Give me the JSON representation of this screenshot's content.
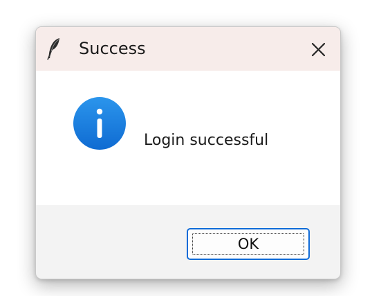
{
  "window": {
    "title": "Success",
    "app_icon": "feather-icon",
    "close_icon": "close-icon"
  },
  "dialog": {
    "message": "Login successful",
    "icon": "info-icon",
    "ok_label": "OK"
  },
  "colors": {
    "titlebar_bg": "#f7ecea",
    "content_bg": "#ffffff",
    "footer_bg": "#f3f3f3",
    "accent": "#0f6bd8",
    "info_blue": "#1a7fe0"
  }
}
